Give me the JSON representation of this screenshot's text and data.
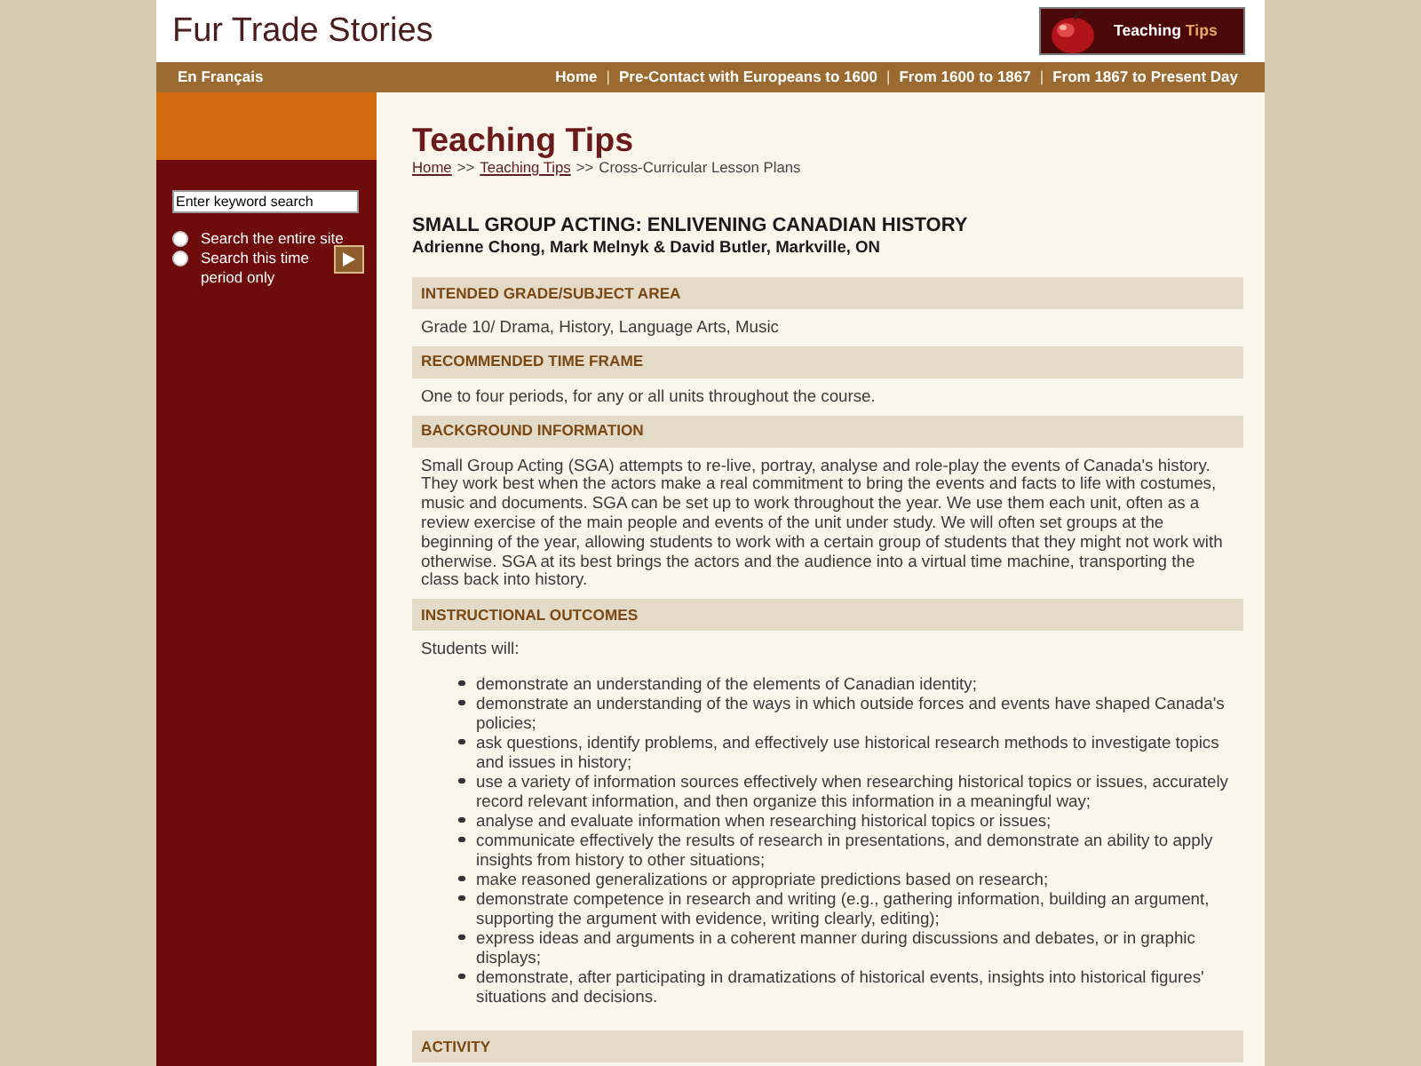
{
  "header": {
    "site_title": "Fur Trade Stories",
    "badge": {
      "text": "Teaching",
      "highlight": "Tips"
    }
  },
  "nav": {
    "language_link": "En Français",
    "items": [
      {
        "kind": "link",
        "text": "Home"
      },
      {
        "kind": "separator",
        "text": "|"
      },
      {
        "kind": "link",
        "text": "Pre-Contact with Europeans to 1600"
      },
      {
        "kind": "separator",
        "text": "|"
      },
      {
        "kind": "link",
        "text": "From 1600 to 1867"
      },
      {
        "kind": "separator",
        "text": "|"
      },
      {
        "kind": "link",
        "text": "From 1867 to Present Day"
      }
    ]
  },
  "sidebar": {
    "search": {
      "value": "Enter keyword search"
    },
    "scope_options": [
      {
        "label": "Search the entire site",
        "selected": false
      },
      {
        "label": "Search this time period only",
        "selected": false
      }
    ]
  },
  "page": {
    "title": "Teaching Tips",
    "breadcrumb": [
      {
        "kind": "link",
        "text": "Home"
      },
      {
        "kind": "separator",
        "text": ">>"
      },
      {
        "kind": "link",
        "text": "Teaching Tips"
      },
      {
        "kind": "separator",
        "text": ">>"
      },
      {
        "kind": "current",
        "text": "Cross-Curricular Lesson Plans"
      }
    ],
    "heading": "SMALL GROUP ACTING: ENLIVENING CANADIAN HISTORY",
    "authors": "Adrienne Chong, Mark Melnyk & David Butler, Markville, ON",
    "sections": [
      {
        "heading": "INTENDED GRADE/SUBJECT AREA",
        "kind": "paragraph",
        "text": "Grade 10/ Drama, History, Language Arts, Music"
      },
      {
        "heading": "RECOMMENDED TIME FRAME",
        "kind": "paragraph",
        "text": "One to four periods, for any or all units throughout the course."
      },
      {
        "heading": "BACKGROUND INFORMATION",
        "kind": "paragraph",
        "text": "Small Group Acting (SGA) attempts to re-live, portray, analyse and role-play the events of Canada's history. They work best when the actors make a real commitment to bring the events and facts to life with costumes, music and documents. SGA can be set up to work throughout the year. We use them each unit, often as a review exercise of the main people and events of the unit under study. We will often set groups at the beginning of the year, allowing students to work with a certain group of students that they might not work with otherwise. SGA at its best brings the actors and the audience into a virtual time machine, transporting the class back into history."
      },
      {
        "heading": "INSTRUCTIONAL OUTCOMES",
        "kind": "list",
        "intro": "Students will:",
        "items": [
          "demonstrate an understanding of the elements of Canadian identity;",
          "demonstrate an understanding of the ways in which outside forces and events have shaped Canada's policies;",
          "ask questions, identify problems, and effectively use historical research methods to investigate topics and issues in history;",
          "use a variety of information sources effectively when researching historical topics or issues, accurately record relevant information, and then organize this information in a meaningful way;",
          "analyse and evaluate information when researching historical topics or issues;",
          "communicate effectively the results of research in presentations, and demonstrate an ability to apply insights from history to other situations;",
          "make reasoned generalizations or appropriate predictions based on research;",
          "demonstrate competence in research and writing (e.g., gathering information, building an argument, supporting the argument with evidence, writing clearly, editing);",
          "express ideas and arguments in a coherent manner during discussions and debates, or in graphic displays;",
          "demonstrate, after participating in dramatizations of historical events, insights into historical figures' situations and decisions."
        ]
      },
      {
        "heading": "ACTIVITY",
        "kind": "heading_only"
      }
    ]
  }
}
